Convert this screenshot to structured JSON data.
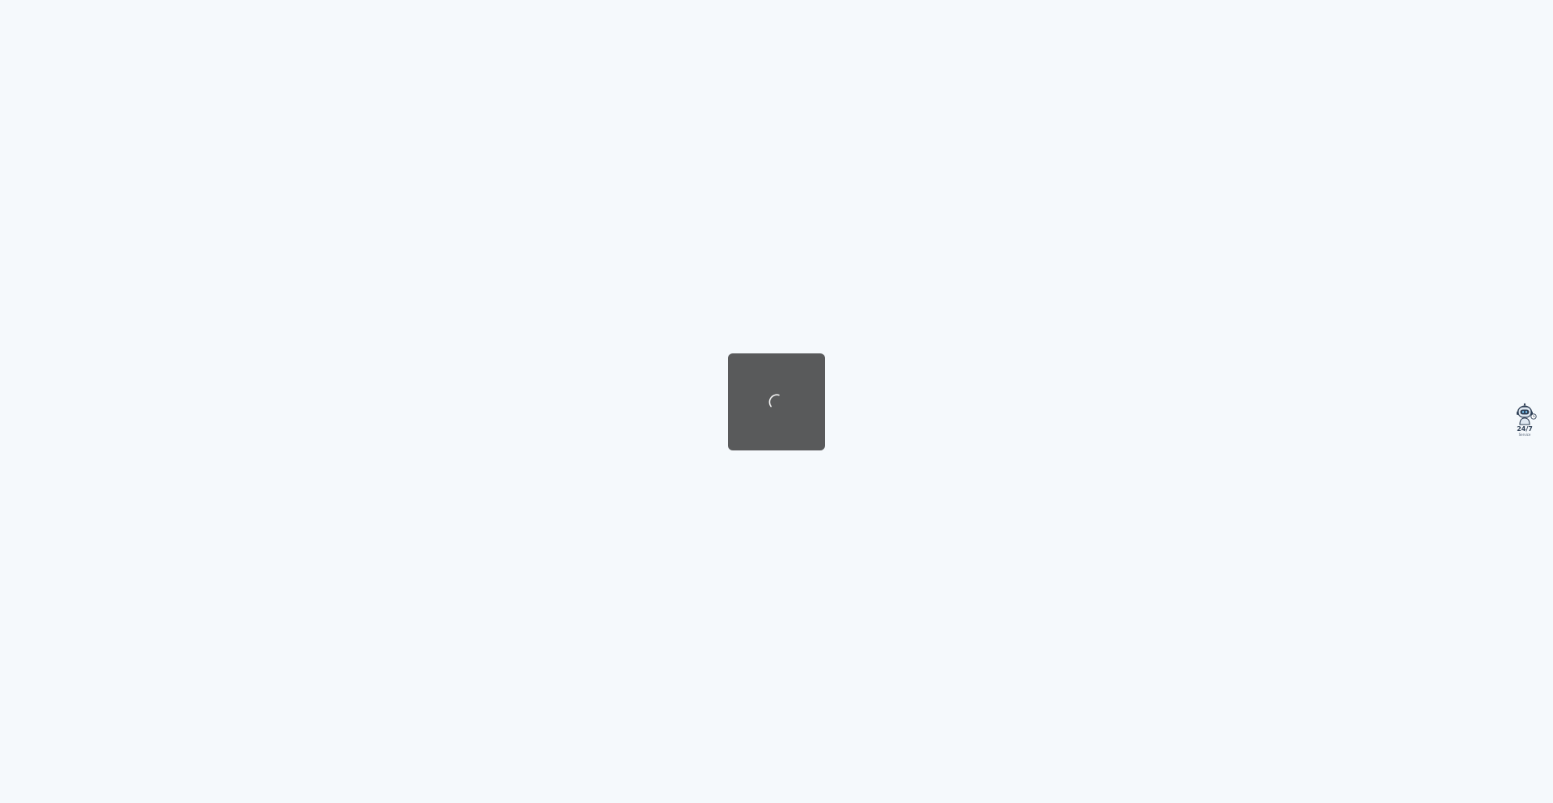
{
  "loading": {
    "icon": "spinner-icon",
    "overlay_color": "#595a5b"
  },
  "service_widget": {
    "icon": "robot-icon",
    "title": "24/7",
    "subtitle": "Service"
  },
  "colors": {
    "background": "#f5f9fc",
    "widget_accent": "#2e3f55"
  }
}
